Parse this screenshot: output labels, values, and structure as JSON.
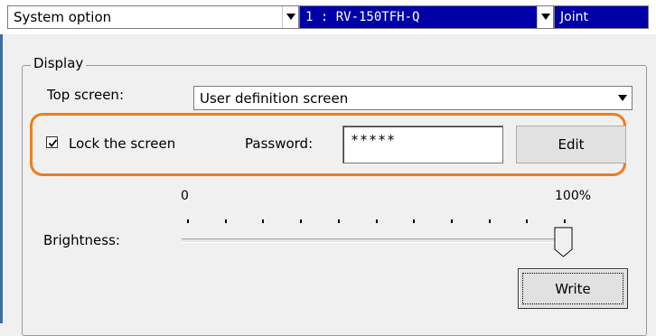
{
  "toolbar": {
    "menu_select": "System option",
    "robot_select": "1 : RV-150TFH-Q",
    "mode_select": "Joint"
  },
  "display": {
    "group_title": "Display",
    "top_screen_label": "Top screen:",
    "top_screen_value": "User definition screen",
    "lock_label": "Lock the screen",
    "lock_checked": true,
    "password_label": "Password:",
    "password_value": "*****",
    "edit_button": "Edit",
    "brightness_label": "Brightness:",
    "brightness_min": "0",
    "brightness_max": "100%",
    "brightness_value": 1.0,
    "write_button": "Write"
  },
  "colors": {
    "highlight": "#f07d1a",
    "robot_select_bg": "#0000a8"
  }
}
